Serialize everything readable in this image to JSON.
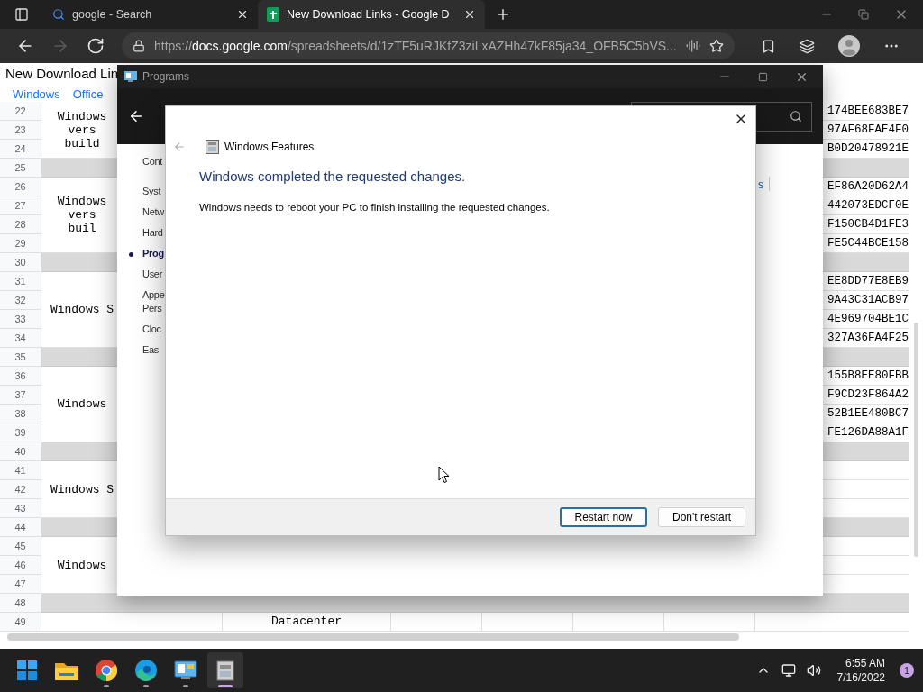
{
  "browser": {
    "tabs": [
      {
        "kind": "search",
        "title": "google - Search",
        "selected": false
      },
      {
        "kind": "sheets",
        "title": "New Download Links - Google D",
        "selected": true
      }
    ],
    "nav_buttons": [
      {
        "kind": "back",
        "disabled": false
      },
      {
        "kind": "forward",
        "disabled": true
      },
      {
        "kind": "refresh",
        "disabled": false
      }
    ],
    "url": {
      "prefix": "https://",
      "host": "docs.google.com",
      "path": "/spreadsheets/d/1zTF5uRJKfZ3ziLxAZHh47kF85ja34_OFB5C5bVS..."
    }
  },
  "sheet": {
    "title": "New Download Lin",
    "menu": [
      "Windows",
      "Office"
    ],
    "groups": [
      {
        "kind": "group",
        "rows": [
          "22",
          "23",
          "24"
        ],
        "lines": [
          "Windows",
          "vers",
          "build"
        ],
        "hashes": [
          "174BEE683BE7",
          "97AF68FAE4F0",
          "B0D20478921E"
        ]
      },
      {
        "kind": "separator",
        "rows": [
          "25"
        ]
      },
      {
        "kind": "group",
        "rows": [
          "26",
          "27",
          "28",
          "29"
        ],
        "lines": [
          "Windows",
          "vers",
          "buil"
        ],
        "hashes": [
          "EF86A20D62A4",
          "442073EDCF0E",
          "F150CB4D1FE3",
          "FE5C44BCE158"
        ]
      },
      {
        "kind": "separator",
        "rows": [
          "30"
        ]
      },
      {
        "kind": "group",
        "rows": [
          "31",
          "32",
          "33",
          "34"
        ],
        "lines": [
          "Windows S"
        ],
        "hashes": [
          "EE8DD77E8EB9",
          "9A43C31ACB97",
          "4E969704BE1C",
          "327A36FA4F25"
        ]
      },
      {
        "kind": "separator",
        "rows": [
          "35"
        ]
      },
      {
        "kind": "group",
        "rows": [
          "36",
          "37",
          "38",
          "39"
        ],
        "lines": [
          "Windows"
        ],
        "hashes": [
          "155B8EE80FBB",
          "F9CD23F864A2",
          "52B1EE480BC7",
          "FE126DA88A1F"
        ]
      },
      {
        "kind": "separator",
        "rows": [
          "40"
        ]
      },
      {
        "kind": "group",
        "rows": [
          "41",
          "42",
          "43"
        ],
        "lines": [
          "Windows S"
        ]
      },
      {
        "kind": "separator",
        "rows": [
          "44"
        ]
      },
      {
        "kind": "group",
        "rows": [
          "45",
          "46",
          "47"
        ],
        "lines": [
          "Windows"
        ]
      },
      {
        "kind": "separator",
        "rows": [
          "48"
        ]
      },
      {
        "kind": "group",
        "rows": [
          "49"
        ],
        "column_2": "Datacenter"
      }
    ]
  },
  "programs_window": {
    "title": "Programs",
    "nav_items": [
      {
        "lines": [
          "Cont"
        ],
        "kind": "home",
        "selected": false
      },
      {
        "lines": [
          "Syst"
        ],
        "kind": "category",
        "selected": false
      },
      {
        "lines": [
          "Netw"
        ],
        "kind": "category",
        "selected": false
      },
      {
        "lines": [
          "Hard"
        ],
        "kind": "category",
        "selected": false
      },
      {
        "lines": [
          "Prog"
        ],
        "kind": "category",
        "selected": true
      },
      {
        "lines": [
          "User"
        ],
        "kind": "category",
        "selected": false
      },
      {
        "lines": [
          "Appe",
          "Pers"
        ],
        "kind": "category",
        "selected": false
      },
      {
        "lines": [
          "Cloc"
        ],
        "kind": "category",
        "selected": false
      },
      {
        "lines": [
          "Eas"
        ],
        "kind": "category",
        "selected": false
      }
    ],
    "link": "s"
  },
  "dialog": {
    "title": "Windows Features",
    "heading": "Windows completed the requested changes.",
    "message": "Windows needs to reboot your PC to finish installing the requested changes.",
    "buttons": [
      {
        "label": "Restart now",
        "default": true
      },
      {
        "label": "Don't restart",
        "default": false
      }
    ]
  },
  "taskbar": {
    "apps": [
      {
        "kind": "start",
        "running": false,
        "selected": false
      },
      {
        "kind": "folder",
        "running": false,
        "selected": false
      },
      {
        "kind": "chrome",
        "running": true,
        "selected": false
      },
      {
        "kind": "edge",
        "running": true,
        "selected": false
      },
      {
        "kind": "control",
        "running": true,
        "selected": false
      },
      {
        "kind": "features",
        "running": true,
        "selected": true
      }
    ],
    "time": "6:55 AM",
    "date": "7/16/2022",
    "notifications": "1"
  }
}
